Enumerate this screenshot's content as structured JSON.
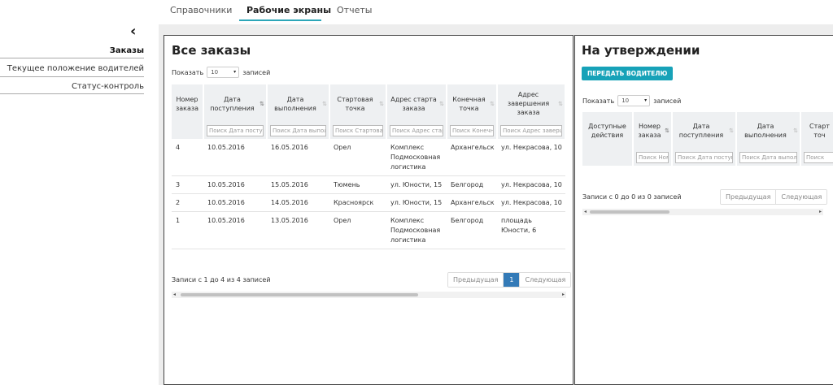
{
  "nav": {
    "tabs": [
      {
        "label": "Справочники"
      },
      {
        "label": "Рабочие экраны"
      },
      {
        "label": "Отчеты"
      }
    ]
  },
  "sidebar": {
    "collapse_icon": "chevron-left-icon",
    "items": [
      {
        "label": "Заказы"
      },
      {
        "label": "Текущее положение водителей"
      },
      {
        "label": "Статус-контроль"
      }
    ]
  },
  "orders": {
    "title": "Все заказы",
    "show_label": "Показать",
    "show_value": "10",
    "show_suffix": "записей",
    "columns": [
      {
        "label": "Номер заказа"
      },
      {
        "label": "Дата поступления"
      },
      {
        "label": "Дата выполнения"
      },
      {
        "label": "Стартовая точка"
      },
      {
        "label": "Адрес старта заказа"
      },
      {
        "label": "Конечная точка"
      },
      {
        "label": "Адрес завершения заказа"
      }
    ],
    "filters": [
      "Поиск Дата поступления",
      "Поиск Дата выполнения",
      "Поиск Стартовая точка",
      "Поиск Адрес старта заказа",
      "Поиск Конечная точка",
      "Поиск Адрес завершения заказа"
    ],
    "rows": [
      {
        "num": "4",
        "recv": "10.05.2016",
        "done": "16.05.2016",
        "start": "Орел",
        "start_addr": "Комплекс Подмосковная логистика",
        "end": "Архангельск",
        "end_addr": "ул. Некрасова, 10"
      },
      {
        "num": "3",
        "recv": "10.05.2016",
        "done": "15.05.2016",
        "start": "Тюмень",
        "start_addr": "ул. Юности, 15",
        "end": "Белгород",
        "end_addr": "ул. Некрасова, 10"
      },
      {
        "num": "2",
        "recv": "10.05.2016",
        "done": "14.05.2016",
        "start": "Красноярск",
        "start_addr": "ул. Юности, 15",
        "end": "Архангельск",
        "end_addr": "ул. Некрасова, 10"
      },
      {
        "num": "1",
        "recv": "10.05.2016",
        "done": "13.05.2016",
        "start": "Орел",
        "start_addr": "Комплекс Подмосковная логистика",
        "end": "Белгород",
        "end_addr": "площадь Юности, 6"
      }
    ],
    "info": "Записи с 1 до 4 из 4 записей",
    "prev": "Предыдущая",
    "page": "1",
    "next": "Следующая"
  },
  "approval": {
    "title": "На утверждении",
    "send_button": "ПЕРЕДАТЬ ВОДИТЕЛЮ",
    "show_label": "Показать",
    "show_value": "10",
    "show_suffix": "записей",
    "columns": [
      {
        "label": "Доступные действия"
      },
      {
        "label": "Номер заказа"
      },
      {
        "label": "Дата поступления"
      },
      {
        "label": "Дата выполнения"
      },
      {
        "label": "Старт точ"
      }
    ],
    "filters": [
      "Поиск Номер заказа",
      "Поиск Дата поступления",
      "Поиск Дата выполнения",
      "Поиск"
    ],
    "info": "Записи с 0 до 0 из 0 записей",
    "prev": "Предыдущая",
    "next": "Следующая"
  },
  "colors": {
    "accent": "#2ca6b8",
    "button": "#17a2b8",
    "page_active": "#337ab7",
    "content_bg": "#ededed"
  }
}
